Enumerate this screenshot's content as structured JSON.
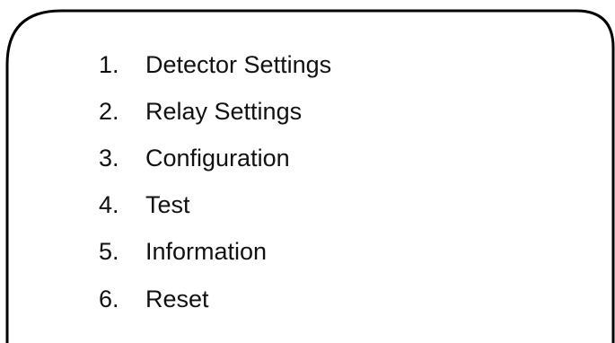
{
  "menu": {
    "items": [
      {
        "number": "1.",
        "label": "Detector Settings"
      },
      {
        "number": "2.",
        "label": "Relay Settings"
      },
      {
        "number": "3.",
        "label": "Configuration"
      },
      {
        "number": "4.",
        "label": "Test"
      },
      {
        "number": "5.",
        "label": "Information"
      },
      {
        "number": "6.",
        "label": "Reset"
      }
    ]
  },
  "colors": {
    "border": "#000000",
    "background": "#ffffff",
    "text": "#111111"
  }
}
